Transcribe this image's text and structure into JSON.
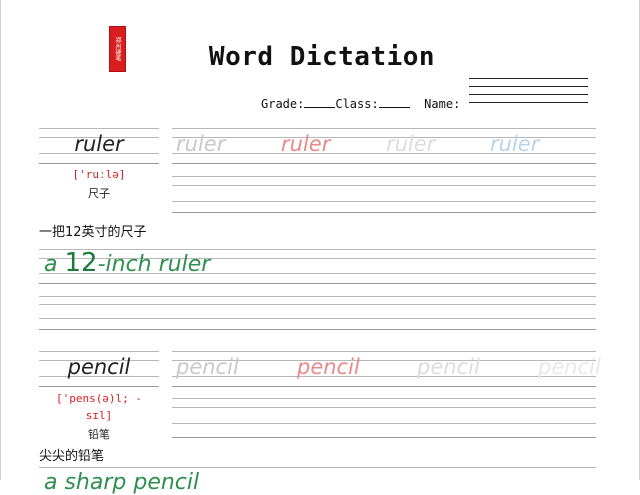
{
  "seal_text": "郑州硬笔",
  "title": "Word Dictation",
  "fields": {
    "grade_label": "Grade:",
    "class_label": "Class:",
    "name_label": "Name:"
  },
  "words": [
    {
      "word": "ruler",
      "phonetic": "['ruːlə]",
      "meaning": "尺子",
      "traces": [
        "ruler",
        "ruler",
        "ruler",
        "ruler"
      ],
      "phrase_cn": "一把12英寸的尺子",
      "phrase_en_pre": "a ",
      "phrase_en_num": "12",
      "phrase_en_post": "-inch ruler"
    },
    {
      "word": "pencil",
      "phonetic_1": "['pens(ə)l; -",
      "phonetic_2": "sɪl]",
      "meaning": "铅笔",
      "traces": [
        "pencil",
        "pencil",
        "pencil",
        "pencil"
      ],
      "phrase_cn": "尖尖的铅笔",
      "phrase_en": "a sharp pencil"
    }
  ],
  "colors": {
    "seal": "#d81e1e",
    "phonetic": "#d81e1e",
    "phrase_en": "#2f8f4f"
  }
}
